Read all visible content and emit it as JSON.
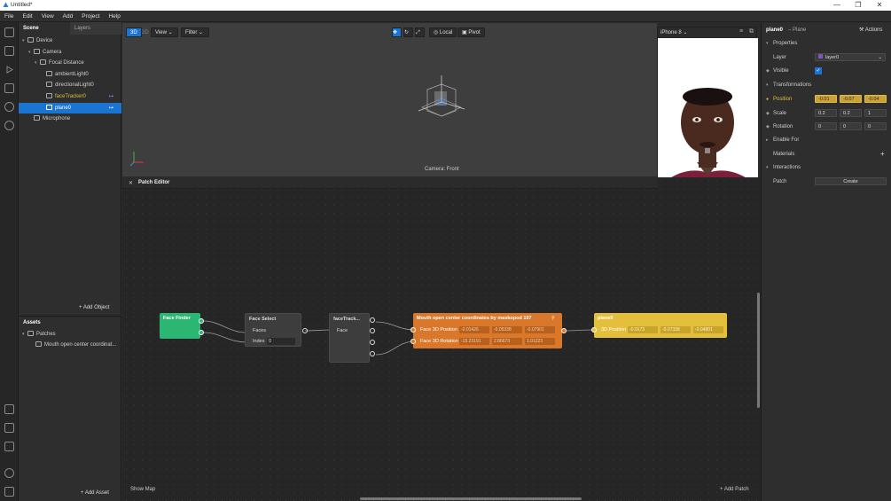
{
  "window": {
    "title": "Untitled*",
    "controls": [
      "—",
      "❐",
      "✕"
    ]
  },
  "menu": [
    "File",
    "Edit",
    "View",
    "Add",
    "Project",
    "Help"
  ],
  "scene": {
    "tabs": [
      "Scene",
      "Layers"
    ],
    "tree": [
      {
        "label": "Device",
        "indent": 0,
        "arrow": "▾",
        "icon": "device-icon"
      },
      {
        "label": "Camera",
        "indent": 1,
        "arrow": "▾",
        "icon": "camera-icon"
      },
      {
        "label": "Focal Distance",
        "indent": 2,
        "arrow": "▾",
        "icon": "focal-distance-icon"
      },
      {
        "label": "ambientLight0",
        "indent": 3,
        "arrow": "",
        "icon": "light-icon"
      },
      {
        "label": "directionalLight0",
        "indent": 3,
        "arrow": "",
        "icon": "light-icon"
      },
      {
        "label": "faceTracker0",
        "indent": 3,
        "arrow": "",
        "icon": "face-tracker-icon",
        "accent": true
      },
      {
        "label": "plane0",
        "indent": 3,
        "arrow": "",
        "icon": "plane-icon",
        "selected": true
      },
      {
        "label": "Microphone",
        "indent": 1,
        "arrow": "",
        "icon": "microphone-icon"
      }
    ],
    "add_object": "Add Object"
  },
  "assets": {
    "title": "Assets",
    "folder": "Patches",
    "item": "Mouth open center coordinat...",
    "add_asset": "Add Asset"
  },
  "viewport": {
    "mode_3d": "3D",
    "mode_2d": "2D",
    "view": "View",
    "filter": "Filter",
    "local": "Local",
    "pivot": "Pivot",
    "camera_label": "Camera: Front"
  },
  "preview": {
    "device": "iPhone 8"
  },
  "patch_editor": {
    "title": "Patch Editor",
    "show_map": "Show Map",
    "add_patch": "Add Patch",
    "nodes": {
      "face_finder": {
        "title": "Face Finder"
      },
      "face_select": {
        "title": "Face Select",
        "faces": "Faces",
        "index_label": "Index",
        "index_value": "0"
      },
      "face_tracker": {
        "title": "faceTrack...",
        "face": "Face"
      },
      "mouth": {
        "title": "Mouth open center coordinates by maskopod 107",
        "pos_label": "Face 3D Position",
        "rot_label": "Face 3D Rotation",
        "pos": [
          "-0.01426",
          "-0.05338",
          "-0.07901"
        ],
        "rot": [
          "-15.23191",
          "2.86673",
          "1.01223"
        ]
      },
      "plane": {
        "title": "plane0",
        "pos_label": "3D Position",
        "pos": [
          "-0.0173",
          "-0.07338",
          "-0.04801"
        ]
      }
    }
  },
  "inspector": {
    "object": "plane0",
    "type": "– Plane",
    "actions": "Actions",
    "properties": "Properties",
    "layer_label": "Layer",
    "layer_value": "layer0",
    "visible_label": "Visible",
    "transformations": "Transformations",
    "position_label": "Position",
    "position": [
      "-0.01",
      "-0.07",
      "-0.04"
    ],
    "scale_label": "Scale",
    "scale": [
      "0.2",
      "0.2",
      "1"
    ],
    "rotation_label": "Rotation",
    "rotation": [
      "0",
      "0",
      "0"
    ],
    "enable_for": "Enable For",
    "materials": "Materials",
    "interactions": "Interactions",
    "patch_label": "Patch",
    "create": "Create"
  },
  "colors": {
    "selection": "#1a74d2",
    "face_finder_node": "#2bb673",
    "mouth_node": "#d9782b",
    "plane_node": "#e3bf3b",
    "highlight": "#caa23a"
  }
}
